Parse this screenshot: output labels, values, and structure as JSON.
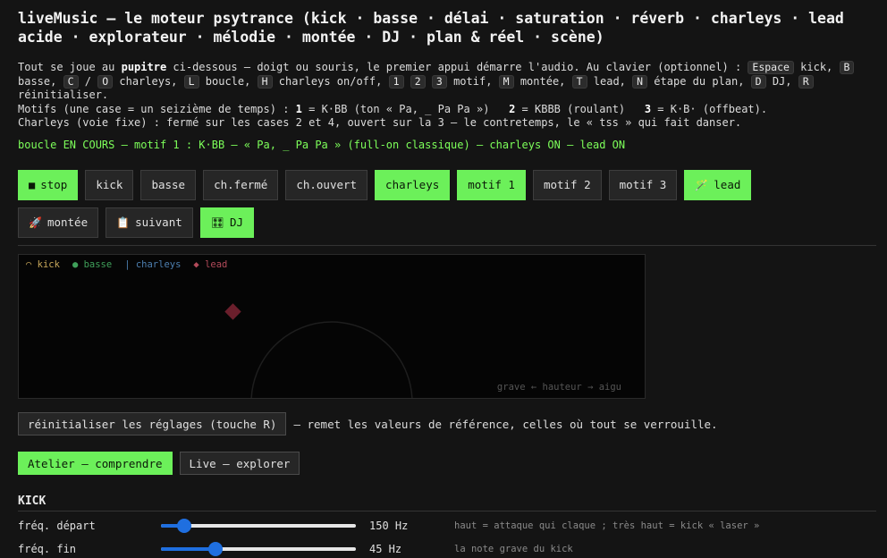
{
  "title": "liveMusic — le moteur psytrance (kick · basse · délai · saturation · réverb · charleys · lead acide · explorateur · mélodie · montée · DJ · plan & réel · scène)",
  "intro": {
    "p1_a": "Tout se joue au ",
    "p1_bold": "pupitre",
    "p1_b": " ci-dessous — doigt ou souris, le premier appui démarre l'audio. Au clavier (optionnel) : ",
    "k_space": "Espace",
    "t_kick": " kick, ",
    "k_b": "B",
    "t_basse": " basse, ",
    "k_c": "C",
    "t_slash": " / ",
    "k_o": "O",
    "t_charleys": " charleys, ",
    "k_l": "L",
    "t_boucle": " boucle, ",
    "k_h": "H",
    "t_charonoff": " charleys on/off, ",
    "k_1": "1",
    "k_2": "2",
    "k_3": "3",
    "t_motif": " motif, ",
    "k_m": "M",
    "t_montee": " montée, ",
    "k_t": "T",
    "t_lead": " lead, ",
    "k_n": "N",
    "t_etape": " étape du plan, ",
    "k_d": "D",
    "t_dj": " DJ, ",
    "k_r": "R",
    "t_reinit": " réinitialiser.",
    "p2_a": "Motifs (une case = un seizième de temps) : ",
    "p2_1": "1",
    "p2_b": " = K·BB (ton « Pa, _ Pa Pa »)   ",
    "p2_2": "2",
    "p2_c": " = KBBB (roulant)   ",
    "p2_3": "3",
    "p2_d": " = K·B· (offbeat).",
    "p3": "Charleys (voie fixe) : fermé sur les cases 2 et 4, ouvert sur la 3 — le contretemps, le « tss » qui fait danser."
  },
  "status": "boucle EN COURS — motif 1 : K·BB — « Pa, _ Pa Pa » (full-on classique) — charleys ON — lead ON",
  "pads": {
    "stop": {
      "icon": "■",
      "label": "stop"
    },
    "kick": {
      "label": "kick"
    },
    "basse": {
      "label": "basse"
    },
    "chferme": {
      "label": "ch.fermé"
    },
    "chouvert": {
      "label": "ch.ouvert"
    },
    "charleys": {
      "label": "charleys"
    },
    "motif1": {
      "label": "motif 1"
    },
    "motif2": {
      "label": "motif 2"
    },
    "motif3": {
      "label": "motif 3"
    },
    "lead": {
      "icon": "🪄",
      "label": "lead"
    },
    "montee": {
      "icon": "🚀",
      "label": "montée"
    },
    "suivant": {
      "icon": "📋",
      "label": "suivant"
    },
    "dj": {
      "icon": "🎛",
      "label": "DJ"
    }
  },
  "scope": {
    "legend_kick": "◠ kick",
    "legend_basse": "● basse",
    "legend_charleys": "| charleys",
    "legend_lead": "◆ lead",
    "axis_note": "grave ← hauteur → aigu",
    "colors": {
      "kick": "#c8a85a",
      "basse": "#3fa05a",
      "charleys": "#4d7fb0",
      "lead": "#b34a5a"
    }
  },
  "reset": {
    "button": "réinitialiser les réglages (touche R)",
    "desc": "— remet les valeurs de référence, celles où tout se verrouille."
  },
  "modes": {
    "atelier": "Atelier — comprendre",
    "live": "Live — explorer"
  },
  "kick_section": {
    "title": "KICK",
    "params": [
      {
        "label": "fréq. départ",
        "value": "150 Hz",
        "hint": "haut = attaque qui claque ; très haut = kick « laser »",
        "level": 0.12
      },
      {
        "label": "fréq. fin",
        "value": "45 Hz",
        "hint": "la note grave du kick",
        "level": 0.28
      }
    ]
  },
  "accent": "#6cf05a"
}
